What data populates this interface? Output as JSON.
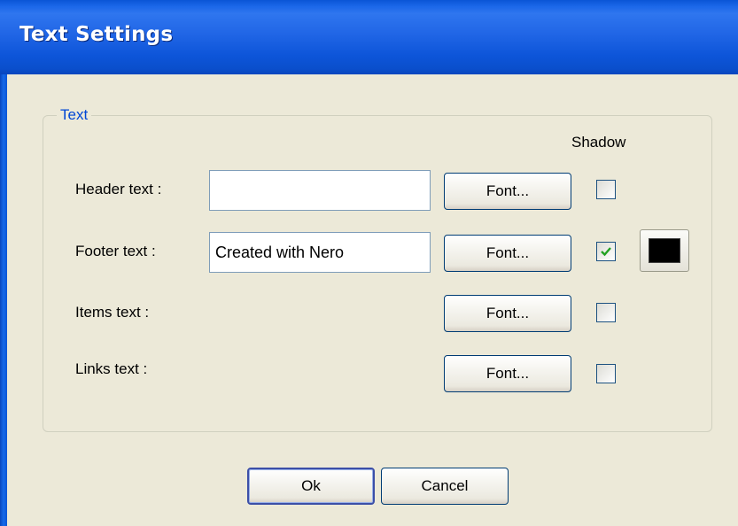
{
  "window": {
    "title": "Text Settings"
  },
  "group": {
    "label": "Text",
    "shadow_header": "Shadow",
    "rows": [
      {
        "label": "Header text :",
        "value": "",
        "font_button": "Font...",
        "shadow_checked": false
      },
      {
        "label": "Footer text :",
        "value": "Created with Nero",
        "font_button": "Font...",
        "shadow_checked": true,
        "shadow_color": "#000000"
      },
      {
        "label": "Items text :",
        "font_button": "Font...",
        "shadow_checked": false
      },
      {
        "label": "Links text :",
        "font_button": "Font...",
        "shadow_checked": false
      }
    ]
  },
  "buttons": {
    "ok": "Ok",
    "cancel": "Cancel"
  },
  "colors": {
    "titlebar": "#0a55d6",
    "group_label": "#0046d5",
    "check_mark": "#21a121"
  }
}
